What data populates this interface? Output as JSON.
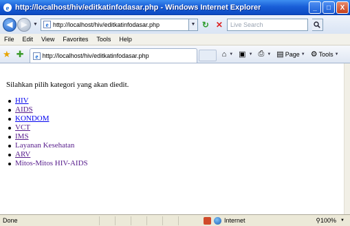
{
  "window": {
    "title": "http://localhost/hiv/editkatinfodasar.php - Windows Internet Explorer",
    "minimize_glyph": "_",
    "maximize_glyph": "□",
    "close_glyph": "X"
  },
  "address_bar": {
    "url": "http://localhost/hiv/editkatinfodasar.php",
    "search_placeholder": "Live Search"
  },
  "menu": [
    "File",
    "Edit",
    "View",
    "Favorites",
    "Tools",
    "Help"
  ],
  "tab": {
    "title": "http://localhost/hiv/editkatinfodasar.php"
  },
  "commands": {
    "page_label": "Page",
    "tools_label": "Tools"
  },
  "page": {
    "instruction": "Silahkan pilih kategori yang akan diedit.",
    "categories": [
      {
        "label": "HIV"
      },
      {
        "label": "AIDS"
      },
      {
        "label": "KONDOM"
      },
      {
        "label": "VCT"
      },
      {
        "label": "IMS"
      },
      {
        "label": "Layanan Kesehatan"
      },
      {
        "label": "ARV"
      },
      {
        "label": "Mitos-Mitos HIV-AIDS"
      }
    ]
  },
  "status": {
    "text": "Done",
    "zone": "Internet",
    "zoom": "100%"
  },
  "colors": {
    "titlebar": "#1a5fd8",
    "link": "#0000ee",
    "visited_link": "#551a8b"
  }
}
